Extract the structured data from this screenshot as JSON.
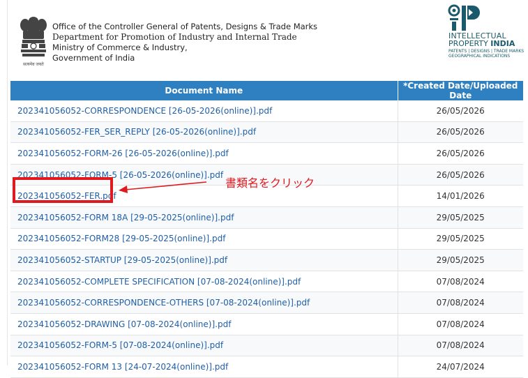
{
  "header": {
    "org_lines": [
      "Office of the Controller General of Patents, Designs & Trade Marks",
      "Department for Promotion of Industry and Internal Trade",
      "Ministry of Commerce & Industry,",
      "Government of India"
    ],
    "emblem_motto": "सत्यमेव जयते",
    "logo": {
      "line1": "INTELLECTUAL",
      "line2a": "PROPERTY ",
      "line2b": "INDIA",
      "sub1": "PATENTS | DESIGNS | TRADE MARKS",
      "sub2": "GEOGRAPHICAL INDICATIONS",
      "color": "#1a5a6c"
    }
  },
  "table": {
    "columns": [
      "Document Name",
      "*Created Date/Uploaded Date"
    ],
    "rows": [
      {
        "name": "202341056052-CORRESPONDENCE [26-05-2026(online)].pdf",
        "date": "26/05/2026"
      },
      {
        "name": "202341056052-FER_SER_REPLY [26-05-2026(online)].pdf",
        "date": "26/05/2026"
      },
      {
        "name": "202341056052-FORM-26 [26-05-2026(online)].pdf",
        "date": "26/05/2026"
      },
      {
        "name": "202341056052-FORM-5 [26-05-2026(online)].pdf",
        "date": "26/05/2026"
      },
      {
        "name": "202341056052-FER.pdf",
        "date": "14/01/2026"
      },
      {
        "name": "202341056052-FORM 18A [29-05-2025(online)].pdf",
        "date": "29/05/2025"
      },
      {
        "name": "202341056052-FORM28 [29-05-2025(online)].pdf",
        "date": "29/05/2025"
      },
      {
        "name": "202341056052-STARTUP [29-05-2025(online)].pdf",
        "date": "29/05/2025"
      },
      {
        "name": "202341056052-COMPLETE SPECIFICATION [07-08-2024(online)].pdf",
        "date": "07/08/2024"
      },
      {
        "name": "202341056052-CORRESPONDENCE-OTHERS [07-08-2024(online)].pdf",
        "date": "07/08/2024"
      },
      {
        "name": "202341056052-DRAWING [07-08-2024(online)].pdf",
        "date": "07/08/2024"
      },
      {
        "name": "202341056052-FORM-5 [07-08-2024(online)].pdf",
        "date": "07/08/2024"
      },
      {
        "name": "202341056052-FORM 13 [24-07-2024(online)].pdf",
        "date": "24/07/2024"
      }
    ]
  },
  "annotation": {
    "label": "書類名をクリック",
    "color": "#e0191e"
  },
  "colors": {
    "header_bg": "#2f80c1",
    "link": "#1f5fa8"
  }
}
